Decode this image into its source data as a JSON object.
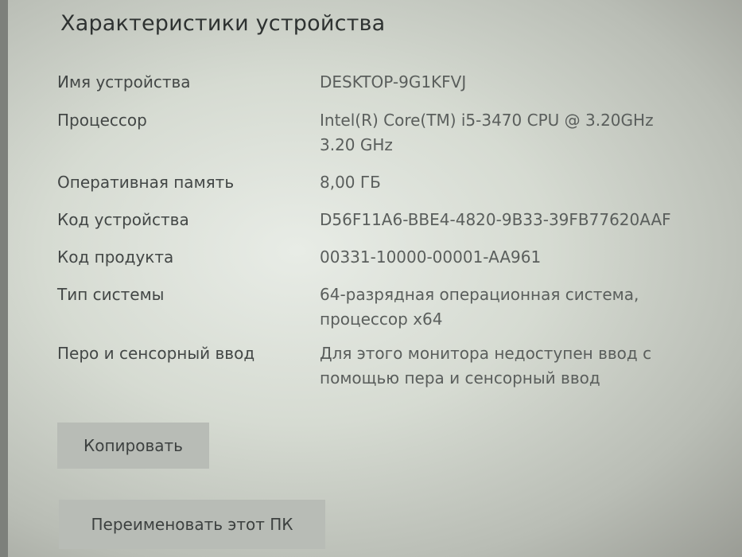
{
  "section": {
    "title": "Характеристики устройства"
  },
  "specs": [
    {
      "label": "Имя устройства",
      "value_lines": [
        "DESKTOP-9G1KFVJ"
      ]
    },
    {
      "label": "Процессор",
      "value_lines": [
        "Intel(R) Core(TM) i5-3470 CPU @ 3.20GHz",
        "3.20 GHz"
      ]
    },
    {
      "label": "Оперативная память",
      "value_lines": [
        "8,00 ГБ"
      ]
    },
    {
      "label": "Код устройства",
      "value_lines": [
        "D56F11A6-BBE4-4820-9B33-39FB77620AAF"
      ]
    },
    {
      "label": "Код продукта",
      "value_lines": [
        "00331-10000-00001-AA961"
      ]
    },
    {
      "label": "Тип системы",
      "value_lines": [
        "64-разрядная операционная система,",
        "процессор x64"
      ]
    },
    {
      "label": "Перо и сенсорный ввод",
      "value_lines": [
        "Для этого монитора недоступен ввод с",
        "помощью пера и сенсорный ввод"
      ]
    }
  ],
  "buttons": {
    "copy_label": "Копировать",
    "rename_label": "Переименовать этот ПК"
  }
}
